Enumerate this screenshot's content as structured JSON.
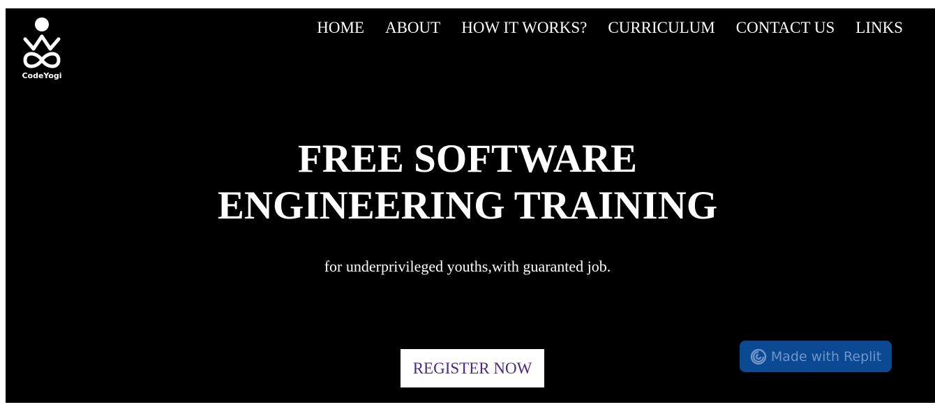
{
  "brand": {
    "logo_text": "CodeYogi",
    "icon": "meditating-figure-infinity-logo"
  },
  "nav": {
    "items": [
      {
        "label": "HOME"
      },
      {
        "label": "ABOUT"
      },
      {
        "label": "HOW IT WORKS?"
      },
      {
        "label": "CURRICULUM"
      },
      {
        "label": "CONTACT US"
      },
      {
        "label": "LINKS"
      }
    ]
  },
  "hero": {
    "headline_line1": "FREE SOFTWARE",
    "headline_line2": "ENGINEERING TRAINING",
    "subheadline": "for underprivileged youths,with guaranted job.",
    "cta_label": "REGISTER NOW"
  },
  "badge": {
    "label": "Made with Replit",
    "icon": "replit-logo-icon"
  },
  "colors": {
    "hero_background": "#000000",
    "text": "#ffffff",
    "cta_text": "#4b2a84",
    "badge_background": "#0b4a93",
    "badge_text": "#6f95c9"
  }
}
